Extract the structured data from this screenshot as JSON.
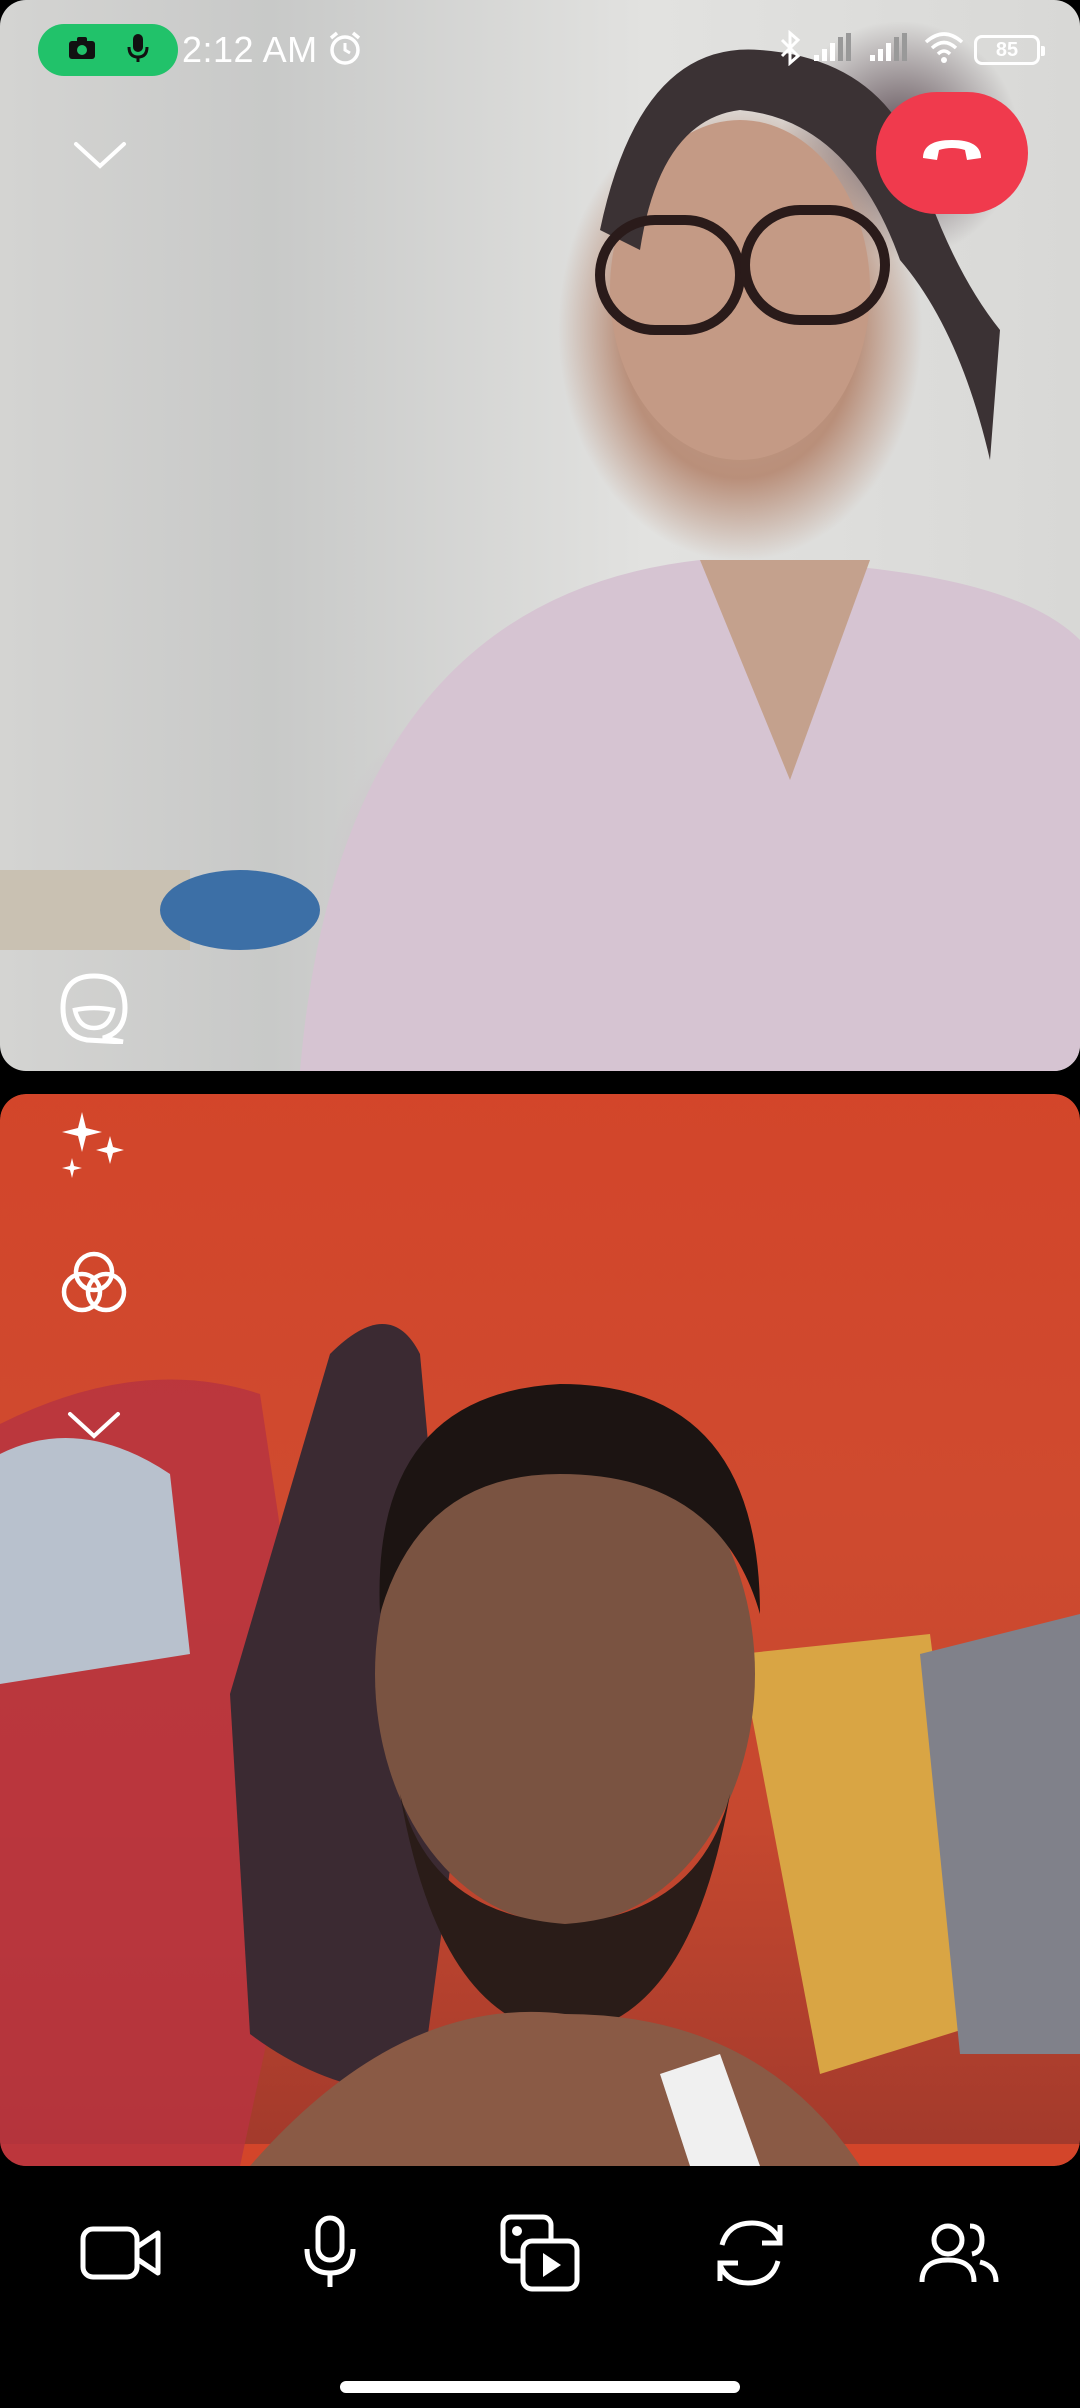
{
  "status_bar": {
    "time": "2:12 AM",
    "battery_level": "85",
    "recording_indicators": [
      "camera-icon",
      "microphone-icon"
    ],
    "icons": [
      "alarm-icon",
      "bluetooth-icon",
      "signal-icon",
      "signal-icon",
      "wifi-icon"
    ]
  },
  "call": {
    "remote_video": "remote-participant-video",
    "local_video": "self-video",
    "end_call_color": "#f03a4d"
  },
  "top_tile_controls": [
    "collapse-chevron-icon",
    "end-call-icon",
    "lens-face-icon"
  ],
  "bottom_tile_controls": [
    "sparkles-effects-icon",
    "filters-circles-icon",
    "more-chevron-icon"
  ],
  "control_bar": [
    "video-camera-icon",
    "microphone-icon",
    "media-share-icon",
    "switch-camera-icon",
    "participants-icon"
  ],
  "colors": {
    "accent_green": "#21c26a",
    "end_call_red": "#f03a4d",
    "background": "#000000"
  }
}
